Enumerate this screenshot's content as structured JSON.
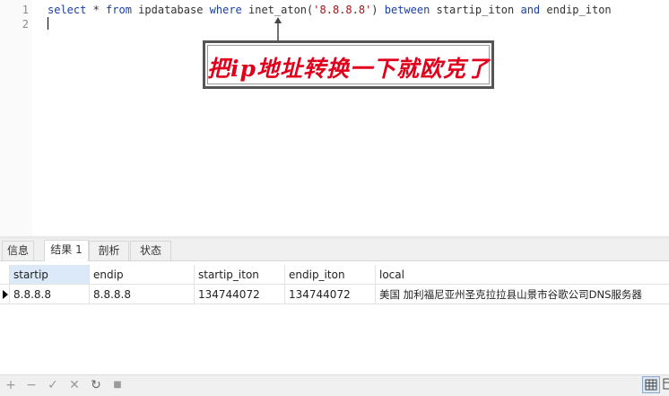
{
  "editor": {
    "line_numbers": [
      "1",
      "2"
    ],
    "sql_tokens": [
      {
        "text": "select",
        "kind": "keyword"
      },
      {
        "text": " * ",
        "kind": "plain"
      },
      {
        "text": "from",
        "kind": "keyword"
      },
      {
        "text": " ipdatabase ",
        "kind": "plain"
      },
      {
        "text": "where",
        "kind": "keyword"
      },
      {
        "text": " inet_aton(",
        "kind": "plain"
      },
      {
        "text": "'8.8.8.8'",
        "kind": "string"
      },
      {
        "text": ") ",
        "kind": "plain"
      },
      {
        "text": "between",
        "kind": "keyword"
      },
      {
        "text": " startip_iton ",
        "kind": "plain"
      },
      {
        "text": "and",
        "kind": "keyword"
      },
      {
        "text": " endip_iton",
        "kind": "plain"
      }
    ]
  },
  "annotation": {
    "text": "把ip地址转换一下就欧克了",
    "color": "#e0001b"
  },
  "tabs": [
    {
      "label": "信息",
      "active": false
    },
    {
      "label": "结果 1",
      "active": true
    },
    {
      "label": "剖析",
      "active": false
    },
    {
      "label": "状态",
      "active": false
    }
  ],
  "result": {
    "columns": [
      "startip",
      "endip",
      "startip_iton",
      "endip_iton",
      "local"
    ],
    "rows": [
      [
        "8.8.8.8",
        "8.8.8.8",
        "134744072",
        "134744072",
        "美国 加利福尼亚州圣克拉拉县山景市谷歌公司DNS服务器"
      ]
    ]
  },
  "toolbar": {
    "buttons": [
      {
        "name": "add-record",
        "glyph": "+"
      },
      {
        "name": "delete-record",
        "glyph": "−"
      },
      {
        "name": "apply-changes",
        "glyph": "✓"
      },
      {
        "name": "discard-changes",
        "glyph": "✕"
      },
      {
        "name": "refresh",
        "glyph": "↻"
      },
      {
        "name": "stop",
        "glyph": "■"
      }
    ]
  }
}
